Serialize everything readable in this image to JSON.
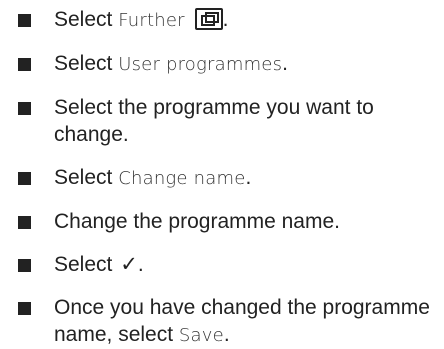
{
  "steps": [
    {
      "prefix": "Select",
      "ui": "Further",
      "suffix": "."
    },
    {
      "prefix": "Select",
      "ui": "User programmes",
      "suffix": "."
    },
    {
      "text": "Select the programme you want to change."
    },
    {
      "prefix": "Select",
      "ui": "Change name",
      "suffix": "."
    },
    {
      "text": "Change the programme name."
    },
    {
      "prefix": "Select",
      "symbol": "✓",
      "suffix": "."
    },
    {
      "prefix": "Once you have changed the programme name, select",
      "ui": "Save",
      "suffix": "."
    }
  ],
  "icons": {
    "further": "further-icon",
    "bullet": "square-bullet-icon"
  }
}
